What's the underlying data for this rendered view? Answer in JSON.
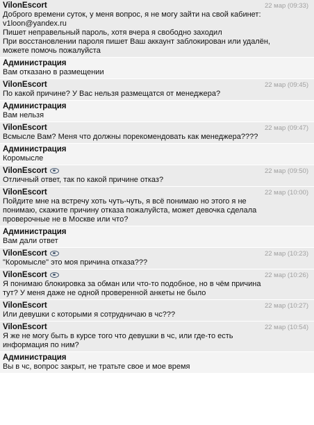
{
  "messages": [
    {
      "role": "user",
      "author": "VilonEscort",
      "eye": false,
      "time": "22 мар (09:33)",
      "text": "Доброго времени суток, у меня вопрос, я не могу зайти на свой кабинет:\nv1loon@yandex.ru\nПишет неправельный пароль, хотя вчера я свободно заходил\nПри восстановлении пароля пишет Ваш аккаунт заблокирован или удалён,\nможете помочь пожалуйста"
    },
    {
      "role": "admin",
      "author": "Администрация",
      "eye": false,
      "time": "",
      "text": "Вам отказано в размещении"
    },
    {
      "role": "user",
      "author": "VilonEscort",
      "eye": false,
      "time": "22 мар (09:45)",
      "text": "По какой причине? У Вас нельзя размещатся от менеджера?"
    },
    {
      "role": "admin",
      "author": "Администрация",
      "eye": false,
      "time": "",
      "text": "Вам нельзя"
    },
    {
      "role": "user",
      "author": "VilonEscort",
      "eye": false,
      "time": "22 мар (09:47)",
      "text": "Всмысле Вам? Меня что должны порекомендовать как менеджера????"
    },
    {
      "role": "admin",
      "author": "Администрация",
      "eye": false,
      "time": "",
      "text": "Коромысле"
    },
    {
      "role": "user",
      "author": "VilonEscort",
      "eye": true,
      "time": "22 мар (09:50)",
      "text": "Отличный ответ, так по какой причине отказ?"
    },
    {
      "role": "user",
      "author": "VilonEscort",
      "eye": false,
      "time": "22 мар (10:00)",
      "text": "Пойдите мне на встречу хоть чуть-чуть, я всё понимаю но этого я не\nпонимаю, скажите причину отказа пожалуйста, может девочка сделала\nпроверочные не в Москве или что?"
    },
    {
      "role": "admin",
      "author": "Администрация",
      "eye": false,
      "time": "",
      "text": "Вам дали ответ"
    },
    {
      "role": "user",
      "author": "VilonEscort",
      "eye": true,
      "time": "22 мар (10:23)",
      "text": "\"Коромысле\" это моя причина отказа???"
    },
    {
      "role": "user",
      "author": "VilonEscort",
      "eye": true,
      "time": "22 мар (10:26)",
      "text": "Я понимаю блокировка за обман или что-то подобное, но в чём причина\nтут? У меня даже не одной проверенной анкеты не было"
    },
    {
      "role": "user",
      "author": "VilonEscort",
      "eye": false,
      "time": "22 мар (10:27)",
      "text": "Или девушки с которыми я сотрудничаю в чс???"
    },
    {
      "role": "user",
      "author": "VilonEscort",
      "eye": false,
      "time": "22 мар (10:54)",
      "text": "Я же не могу быть в курсе того что девушки в чс, или где-то есть\nинформация по ним?"
    },
    {
      "role": "admin",
      "author": "Администрация",
      "eye": false,
      "time": "",
      "text": "Вы в чс, вопрос закрыт, не тратьте свое и мое время"
    }
  ]
}
